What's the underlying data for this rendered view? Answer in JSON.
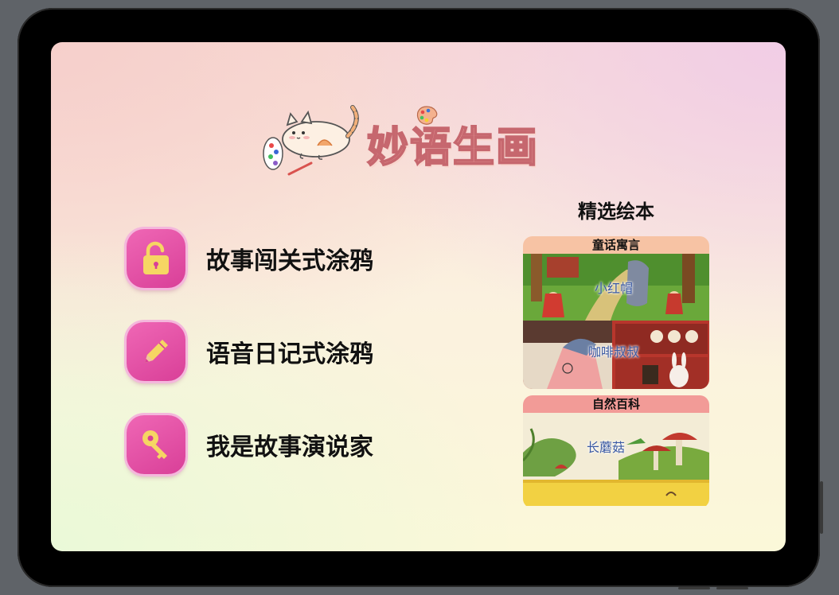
{
  "app": {
    "title": "妙语生画"
  },
  "menu": [
    {
      "label": "故事闯关式涂鸦",
      "icon": "unlock-icon"
    },
    {
      "label": "语音日记式涂鸦",
      "icon": "pencil-icon"
    },
    {
      "label": "我是故事演说家",
      "icon": "key-icon"
    }
  ],
  "featured": {
    "title": "精选绘本",
    "categories": [
      {
        "name": "童话寓言",
        "books": [
          {
            "title": "小红帽"
          },
          {
            "title": "咖啡叔叔"
          }
        ]
      },
      {
        "name": "自然百科",
        "books": [
          {
            "title": "长蘑菇"
          }
        ]
      }
    ]
  },
  "colors": {
    "accent": "#e0479f",
    "icon_fill": "#f6d663",
    "title_pink": "#f1a4a0"
  }
}
